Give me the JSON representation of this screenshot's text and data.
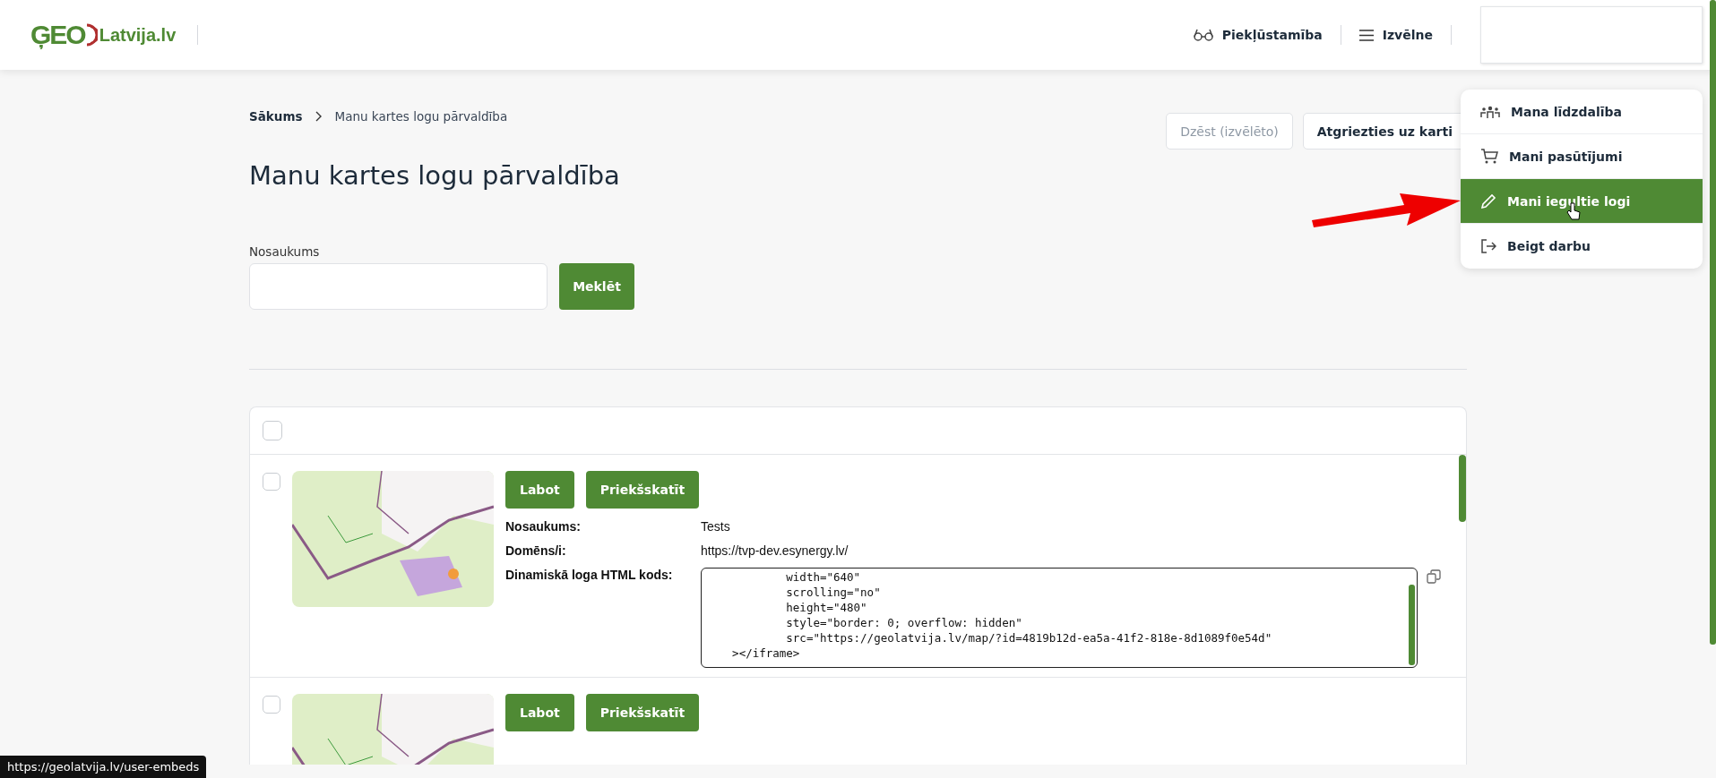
{
  "header": {
    "logo_mark": "ĢEO",
    "logo_text": "Latvija.lv",
    "accessibility": "Piekļūstamība",
    "menu": "Izvēlne"
  },
  "user_menu": {
    "items": [
      {
        "label": "Mana līdzdalība",
        "selected": false
      },
      {
        "label": "Mani pasūtījumi",
        "selected": false
      },
      {
        "label": "Mani iegultie logi",
        "selected": true
      },
      {
        "label": "Beigt darbu",
        "selected": false
      }
    ]
  },
  "breadcrumb": [
    {
      "label": "Sākums"
    },
    {
      "label": "Manu kartes logu pārvaldība"
    }
  ],
  "title": "Manu kartes logu pārvaldība",
  "actions": [
    {
      "label": "Dzēst (izvēlēto)",
      "disabled": true
    },
    {
      "label": "Atgriezties uz karti",
      "disabled": false
    }
  ],
  "search": {
    "label": "Nosaukums",
    "button": "Meklēt"
  },
  "list": {
    "select_all": {
      "checked": false
    },
    "items": [
      {
        "checked": false,
        "buttons": [
          "Labot",
          "Priekšskatīt"
        ],
        "fields": [
          {
            "kind": "text",
            "label": "Nosaukums:",
            "value": "Tests"
          },
          {
            "kind": "text",
            "label": "Domēns/i:",
            "value": "https://tvp-dev.esynergy.lv/"
          },
          {
            "kind": "code",
            "label": "Dinamiskā loga HTML kods:",
            "lines": [
              "            width=\"640\"",
              "            scrolling=\"no\"",
              "            height=\"480\"",
              "            style=\"border: 0; overflow: hidden\"",
              "            src=\"https://geolatvija.lv/map/?id=4819b12d-ea5a-41f2-818e-8d1089f0e54d\"",
              "    ></iframe>"
            ]
          }
        ]
      },
      {
        "checked": false,
        "buttons": [
          "Labot",
          "Priekšskatīt"
        ]
      }
    ]
  },
  "status_url": "https://geolatvija.lv/user-embeds"
}
